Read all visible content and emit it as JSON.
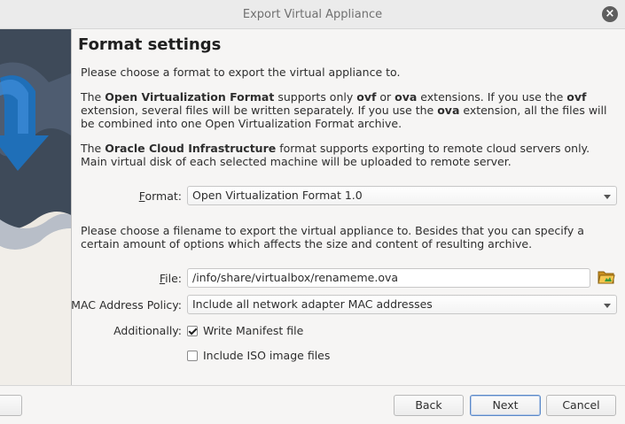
{
  "window": {
    "title": "Export Virtual Appliance"
  },
  "page": {
    "heading": "Format settings",
    "intro": "Please choose a format to export the virtual appliance to.",
    "ovf_para": {
      "t1": "The ",
      "b1": "Open Virtualization Format",
      "t2": " supports only ",
      "b2": "ovf",
      "t3": " or ",
      "b3": "ova",
      "t4": " extensions. If you use the ",
      "b4": "ovf",
      "t5": " extension, several files will be written separately. If you use the ",
      "b5": "ova",
      "t6": " extension, all the files will be combined into one Open Virtualization Format archive."
    },
    "oci_para": {
      "t1": "The ",
      "b1": "Oracle Cloud Infrastructure",
      "t2": " format supports exporting to remote cloud servers only. Main virtual disk of each selected machine will be uploaded to remote server."
    },
    "format_label": "Format:",
    "format_value": "Open Virtualization Format 1.0",
    "filename_para": "Please choose a filename to export the virtual appliance to. Besides that you can specify a certain amount of options which affects the size and content of resulting archive.",
    "file_label": "File:",
    "file_value": "/info/share/virtualbox/renameme.ova",
    "mac_label": "MAC Address Policy:",
    "mac_value": "Include all network adapter MAC addresses",
    "additionally_label": "Additionally:",
    "manifest_label": "Write Manifest file",
    "manifest_checked": true,
    "iso_label": "Include ISO image files",
    "iso_checked": false
  },
  "buttons": {
    "back": "Back",
    "next": "Next",
    "cancel": "Cancel"
  },
  "icons": {
    "close": "close-icon",
    "folder": "folder-open-icon",
    "check": "checkmark-icon"
  },
  "colors": {
    "accent": "#5a88c9",
    "watermark_arrow": "#1f6fb8"
  }
}
